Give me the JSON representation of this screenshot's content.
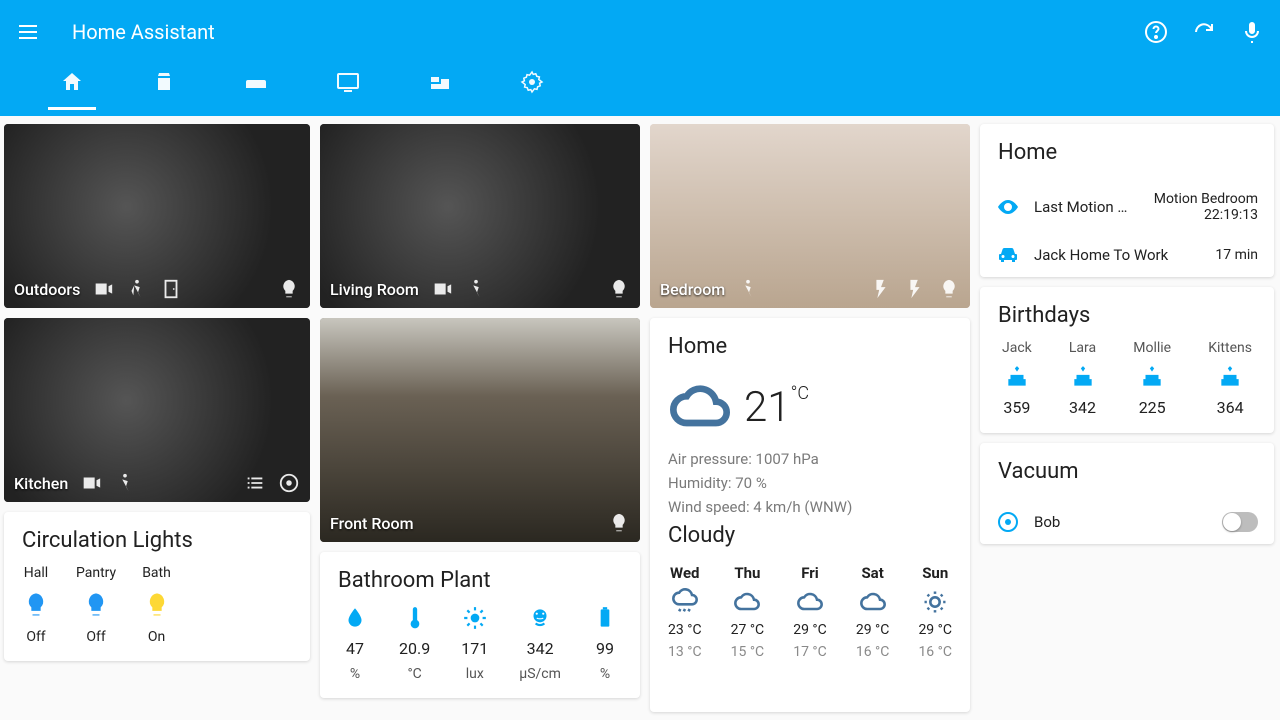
{
  "app": {
    "title": "Home Assistant"
  },
  "cameras": {
    "outdoors": "Outdoors",
    "living": "Living Room",
    "bedroom": "Bedroom",
    "kitchen": "Kitchen",
    "front": "Front Room"
  },
  "lights_card": {
    "title": "Circulation Lights",
    "items": [
      {
        "name": "Hall",
        "state": "Off"
      },
      {
        "name": "Pantry",
        "state": "Off"
      },
      {
        "name": "Bath",
        "state": "On"
      }
    ]
  },
  "plant_card": {
    "title": "Bathroom Plant",
    "items": [
      {
        "icon": "drop",
        "value": "47",
        "unit": "%"
      },
      {
        "icon": "thermo",
        "value": "20.9",
        "unit": "°C"
      },
      {
        "icon": "sun",
        "value": "171",
        "unit": "lux"
      },
      {
        "icon": "fert",
        "value": "342",
        "unit": "µS/cm"
      },
      {
        "icon": "batt",
        "value": "99",
        "unit": "%"
      }
    ]
  },
  "weather": {
    "title": "Home",
    "temp": "21",
    "unit": "°C",
    "pressure": "Air pressure: 1007 hPa",
    "humidity": "Humidity: 70 %",
    "wind": "Wind speed: 4 km/h (WNW)",
    "condition": "Cloudy",
    "forecast": [
      {
        "day": "Wed",
        "icon": "rain",
        "hi": "23 °C",
        "lo": "13 °C"
      },
      {
        "day": "Thu",
        "icon": "cloud",
        "hi": "27 °C",
        "lo": "15 °C"
      },
      {
        "day": "Fri",
        "icon": "cloud",
        "hi": "29 °C",
        "lo": "17 °C"
      },
      {
        "day": "Sat",
        "icon": "cloud",
        "hi": "29 °C",
        "lo": "16 °C"
      },
      {
        "day": "Sun",
        "icon": "sun",
        "hi": "29 °C",
        "lo": "16 °C"
      }
    ]
  },
  "home_card": {
    "title": "Home",
    "rows": [
      {
        "icon": "eye",
        "name": "Last Motion …",
        "value": "Motion Bedroom\n22:19:13"
      },
      {
        "icon": "car",
        "name": "Jack Home To Work",
        "value": "17 min"
      }
    ]
  },
  "birthdays": {
    "title": "Birthdays",
    "items": [
      {
        "name": "Jack",
        "days": "359"
      },
      {
        "name": "Lara",
        "days": "342"
      },
      {
        "name": "Mollie",
        "days": "225"
      },
      {
        "name": "Kittens",
        "days": "364"
      }
    ]
  },
  "vacuum": {
    "title": "Vacuum",
    "name": "Bob"
  }
}
